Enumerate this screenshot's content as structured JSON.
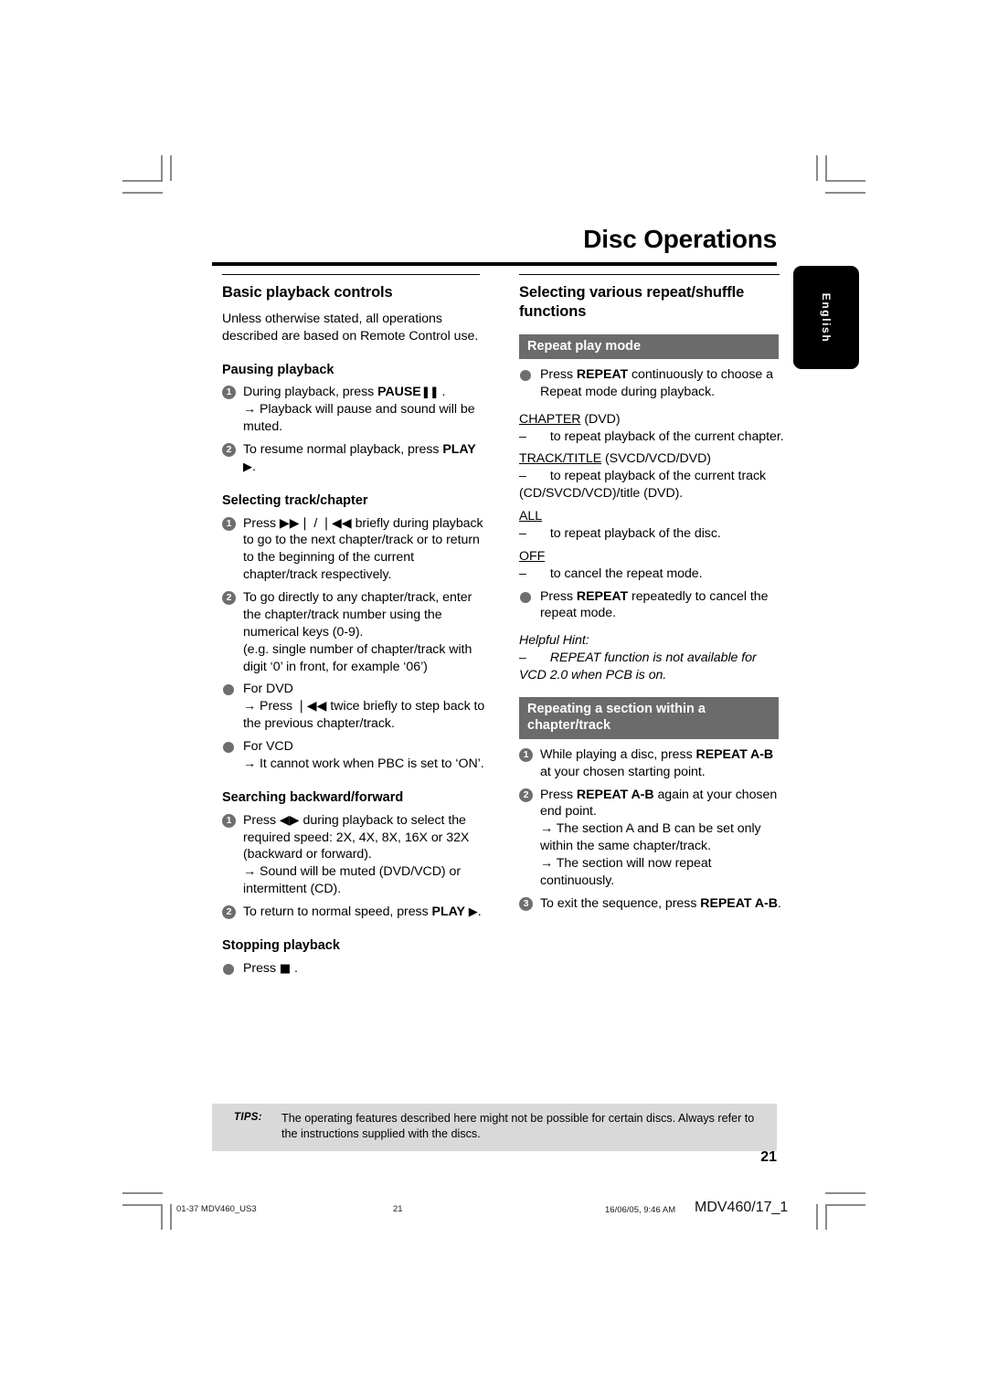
{
  "page": {
    "title": "Disc Operations",
    "language_tab": "English",
    "page_number": "21"
  },
  "left_column": {
    "heading": "Basic playback controls",
    "intro": "Unless otherwise stated, all operations described are based on Remote Control use.",
    "sections": [
      {
        "heading": "Pausing playback",
        "items": [
          {
            "marker": "1",
            "text": "During playback, press ",
            "bold": "PAUSE",
            "symbol": "❚❚",
            "tail": " .",
            "arrow": "→ Playback will pause and sound will be muted."
          },
          {
            "marker": "2",
            "text": "To resume normal playback, press ",
            "bold": "PLAY",
            "symbol": "▶",
            "tail": "."
          }
        ]
      },
      {
        "heading": "Selecting track/chapter",
        "items": [
          {
            "marker": "1",
            "text": "Press ▶▶❘ / ❘◀◀ briefly during playback to go to the next chapter/track or to return to the beginning of the current chapter/track respectively."
          },
          {
            "marker": "2",
            "text": "To go directly to any chapter/track, enter the chapter/track number using the numerical keys (0-9).",
            "note": "(e.g. single number of chapter/track with digit ‘0’ in front, for example ‘06’)"
          },
          {
            "marker": "bullet",
            "text": "For DVD",
            "arrow": "→ Press ❘◀◀ twice briefly to step back to the previous chapter/track."
          },
          {
            "marker": "bullet",
            "text": "For VCD",
            "arrow": "→ It cannot work when PBC is set to ‘ON’."
          }
        ]
      },
      {
        "heading": "Searching backward/forward",
        "items": [
          {
            "marker": "1",
            "text": "Press ◀▶ during playback to select the required speed: 2X, 4X, 8X, 16X or 32X (backward or forward).",
            "arrow": "→ Sound will be muted (DVD/VCD) or intermittent (CD)."
          },
          {
            "marker": "2",
            "text": "To return to normal speed, press ",
            "bold": "PLAY",
            "symbol": "▶",
            "tail": "."
          }
        ]
      },
      {
        "heading": "Stopping playback",
        "items": [
          {
            "marker": "bullet",
            "text": "Press ",
            "symbol": "■",
            "tail": " ."
          }
        ]
      }
    ]
  },
  "right_column": {
    "heading": "Selecting various repeat/shuffle functions",
    "bar_repeat": "Repeat play mode",
    "repeat_intro": {
      "text_before": "Press ",
      "bold": "REPEAT",
      "text_after": " continuously to choose a Repeat mode during playback."
    },
    "modes": [
      {
        "name": "CHAPTER",
        "qualifier": " (DVD)",
        "desc": "to repeat playback of the current chapter."
      },
      {
        "name": "TRACK/TITLE",
        "qualifier": " (SVCD/VCD/DVD)",
        "desc": "to repeat playback of the current track (CD/SVCD/VCD)/title (DVD)."
      },
      {
        "name": "ALL",
        "qualifier": "",
        "desc": "to repeat playback of the disc."
      },
      {
        "name": "OFF",
        "qualifier": "",
        "desc": "to cancel the repeat mode."
      }
    ],
    "cancel_item": {
      "text_before": "Press ",
      "bold": "REPEAT",
      "text_after": " repeatedly to cancel the repeat mode."
    },
    "hint_label": "Helpful Hint:",
    "hint_text": "REPEAT function is not available for VCD 2.0 when PCB is on.",
    "bar_section": "Repeating a section within a chapter/track",
    "section_items": [
      {
        "marker": "1",
        "text_before": "While playing a disc, press ",
        "bold": "REPEAT A-B",
        "text_after": " at your chosen starting point."
      },
      {
        "marker": "2",
        "text_before": "Press ",
        "bold": "REPEAT A-B",
        "text_after": " again at your chosen end point.",
        "arrow1": "→ The section A and B can be set only within the same chapter/track.",
        "arrow2": "→ The section will now repeat continuously."
      },
      {
        "marker": "3",
        "text_before": "To exit the sequence, press ",
        "bold": "REPEAT A-B",
        "text_after": "."
      }
    ]
  },
  "tips": {
    "label": "TIPS:",
    "text": "The operating features described here might not be possible for certain discs.  Always refer to the instructions supplied with the discs."
  },
  "footer": {
    "file": "01-37 MDV460_US3",
    "page": "21",
    "timestamp": "16/06/05, 9:46 AM",
    "doc_id": "MDV460/17_1"
  }
}
